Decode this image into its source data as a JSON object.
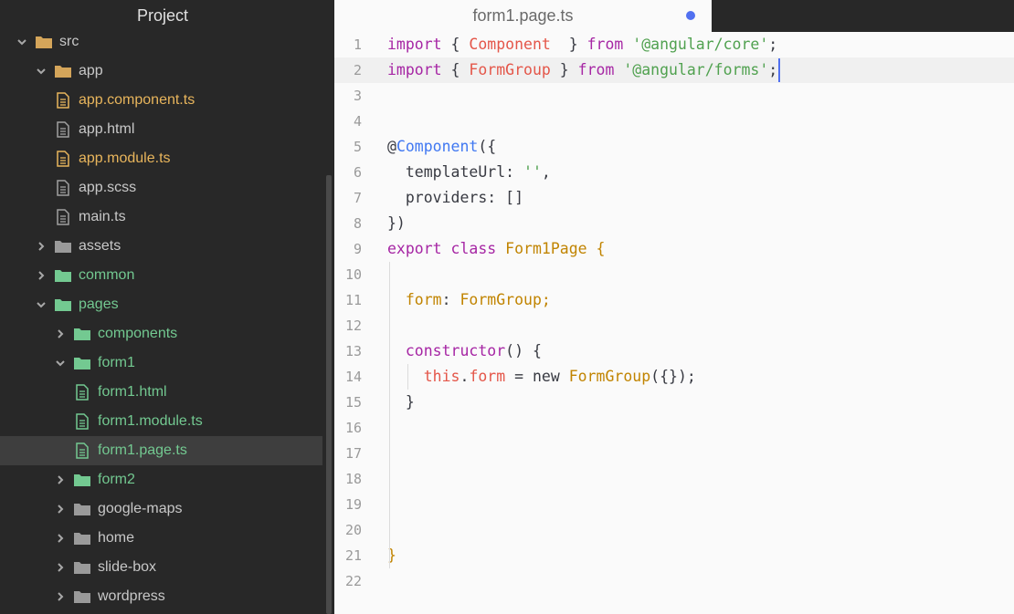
{
  "sidebar": {
    "title": "Project",
    "tree": [
      {
        "label": "src",
        "type": "folder",
        "expanded": true,
        "depth": 0,
        "color": "plain",
        "folder_color": "#d4a55a"
      },
      {
        "label": "app",
        "type": "folder",
        "expanded": true,
        "depth": 1,
        "color": "plain",
        "folder_color": "#d4a55a"
      },
      {
        "label": "app.component.ts",
        "type": "file",
        "depth": 2,
        "color": "orange"
      },
      {
        "label": "app.html",
        "type": "file",
        "depth": 2,
        "color": "plain"
      },
      {
        "label": "app.module.ts",
        "type": "file",
        "depth": 2,
        "color": "orange"
      },
      {
        "label": "app.scss",
        "type": "file",
        "depth": 2,
        "color": "plain"
      },
      {
        "label": "main.ts",
        "type": "file",
        "depth": 2,
        "color": "plain"
      },
      {
        "label": "assets",
        "type": "folder",
        "expanded": false,
        "depth": 1,
        "color": "plain",
        "folder_color": "#9a9a9a"
      },
      {
        "label": "common",
        "type": "folder",
        "expanded": false,
        "depth": 1,
        "color": "green",
        "folder_color": "#73c991"
      },
      {
        "label": "pages",
        "type": "folder",
        "expanded": true,
        "depth": 1,
        "color": "green",
        "folder_color": "#73c991"
      },
      {
        "label": "components",
        "type": "folder",
        "expanded": false,
        "depth": 2,
        "color": "green",
        "folder_color": "#73c991"
      },
      {
        "label": "form1",
        "type": "folder",
        "expanded": true,
        "depth": 2,
        "color": "green",
        "folder_color": "#73c991"
      },
      {
        "label": "form1.html",
        "type": "file",
        "depth": 3,
        "color": "green"
      },
      {
        "label": "form1.module.ts",
        "type": "file",
        "depth": 3,
        "color": "green"
      },
      {
        "label": "form1.page.ts",
        "type": "file",
        "depth": 3,
        "color": "green",
        "selected": true
      },
      {
        "label": "form2",
        "type": "folder",
        "expanded": false,
        "depth": 2,
        "color": "green",
        "folder_color": "#73c991"
      },
      {
        "label": "google-maps",
        "type": "folder",
        "expanded": false,
        "depth": 2,
        "color": "plain",
        "folder_color": "#9a9a9a"
      },
      {
        "label": "home",
        "type": "folder",
        "expanded": false,
        "depth": 2,
        "color": "plain",
        "folder_color": "#9a9a9a"
      },
      {
        "label": "slide-box",
        "type": "folder",
        "expanded": false,
        "depth": 2,
        "color": "plain",
        "folder_color": "#9a9a9a"
      },
      {
        "label": "wordpress",
        "type": "folder",
        "expanded": false,
        "depth": 2,
        "color": "plain",
        "folder_color": "#9a9a9a"
      }
    ]
  },
  "tab": {
    "label": "form1.page.ts",
    "modified_indicator_color": "#5170f0"
  },
  "editor": {
    "active_line": 2,
    "lines": [
      {
        "n": "1",
        "tokens": [
          [
            "k",
            "import"
          ],
          [
            "d",
            " { "
          ],
          [
            "r",
            "Component"
          ],
          [
            "d",
            "  } "
          ],
          [
            "k",
            "from"
          ],
          [
            "d",
            " "
          ],
          [
            "s",
            "'@angular/core'"
          ],
          [
            "d",
            ";"
          ]
        ]
      },
      {
        "n": "2",
        "tokens": [
          [
            "k",
            "import"
          ],
          [
            "d",
            " { "
          ],
          [
            "r",
            "FormGroup"
          ],
          [
            "d",
            " } "
          ],
          [
            "k",
            "from"
          ],
          [
            "d",
            " "
          ],
          [
            "s",
            "'@angular/forms'"
          ],
          [
            "d",
            ";"
          ]
        ]
      },
      {
        "n": "3",
        "tokens": []
      },
      {
        "n": "4",
        "tokens": []
      },
      {
        "n": "5",
        "tokens": [
          [
            "d",
            "@"
          ],
          [
            "f",
            "Component"
          ],
          [
            "d",
            "({"
          ]
        ]
      },
      {
        "n": "6",
        "tokens": [
          [
            "d",
            "  templateUrl: "
          ],
          [
            "s",
            "''"
          ],
          [
            "d",
            ","
          ]
        ]
      },
      {
        "n": "7",
        "tokens": [
          [
            "d",
            "  providers: []"
          ]
        ]
      },
      {
        "n": "8",
        "tokens": [
          [
            "d",
            "})"
          ]
        ]
      },
      {
        "n": "9",
        "tokens": [
          [
            "k",
            "export"
          ],
          [
            "d",
            " "
          ],
          [
            "k",
            "class"
          ],
          [
            "d",
            " "
          ],
          [
            "t",
            "Form1Page"
          ],
          [
            "d",
            " "
          ],
          [
            "t",
            "{"
          ]
        ]
      },
      {
        "n": "10",
        "tokens": []
      },
      {
        "n": "11",
        "tokens": [
          [
            "d",
            "  "
          ],
          [
            "t",
            "form"
          ],
          [
            "d",
            ": "
          ],
          [
            "t",
            "FormGroup;"
          ]
        ]
      },
      {
        "n": "12",
        "tokens": []
      },
      {
        "n": "13",
        "tokens": [
          [
            "d",
            "  "
          ],
          [
            "k",
            "constructor"
          ],
          [
            "d",
            "() {"
          ]
        ]
      },
      {
        "n": "14",
        "tokens": [
          [
            "d",
            "    "
          ],
          [
            "r",
            "this"
          ],
          [
            "d",
            "."
          ],
          [
            "r",
            "form"
          ],
          [
            "d",
            " = new "
          ],
          [
            "t",
            "FormGroup"
          ],
          [
            "d",
            "({});"
          ]
        ]
      },
      {
        "n": "15",
        "tokens": [
          [
            "d",
            "  }"
          ]
        ]
      },
      {
        "n": "16",
        "tokens": []
      },
      {
        "n": "17",
        "tokens": []
      },
      {
        "n": "18",
        "tokens": []
      },
      {
        "n": "19",
        "tokens": []
      },
      {
        "n": "20",
        "tokens": []
      },
      {
        "n": "21",
        "tokens": [
          [
            "t",
            "}"
          ]
        ]
      },
      {
        "n": "22",
        "tokens": []
      }
    ]
  }
}
